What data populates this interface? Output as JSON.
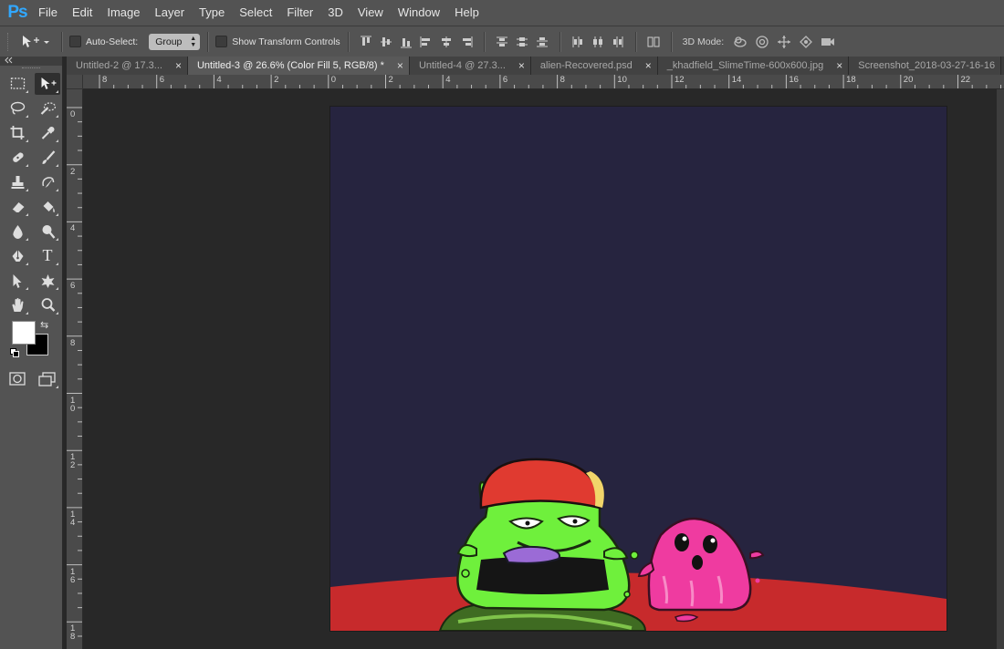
{
  "app": {
    "logo": "Ps"
  },
  "menu": [
    "File",
    "Edit",
    "Image",
    "Layer",
    "Type",
    "Select",
    "Filter",
    "3D",
    "View",
    "Window",
    "Help"
  ],
  "options": {
    "auto_select_label": "Auto-Select:",
    "auto_select_checked": false,
    "auto_select_target": "Group",
    "show_transform_label": "Show Transform Controls",
    "show_transform_checked": false,
    "mode3d_label": "3D Mode:"
  },
  "tabs": [
    {
      "title": "Untitled-2 @ 17.3...",
      "active": false
    },
    {
      "title": "Untitled-3 @ 26.6% (Color Fill 5, RGB/8) *",
      "active": true
    },
    {
      "title": "Untitled-4 @ 27.3...",
      "active": false
    },
    {
      "title": "alien-Recovered.psd",
      "active": false
    },
    {
      "title": "_khadfield_SlimeTime-600x600.jpg",
      "active": false
    },
    {
      "title": "Screenshot_2018-03-27-16-16",
      "active": false
    }
  ],
  "tab_close_glyph": "×",
  "ruler": {
    "horizontal": [
      "8",
      "6",
      "4",
      "2",
      "0",
      "2",
      "4",
      "6",
      "8",
      "10",
      "12",
      "14",
      "16",
      "18",
      "20",
      "22"
    ],
    "vertical": [
      "0",
      "2",
      "4",
      "6",
      "8",
      "10",
      "12",
      "14",
      "16",
      "18"
    ]
  },
  "colors": {
    "foreground": "#ffffff",
    "background": "#000000",
    "canvas_bg": "#26243f",
    "ground": "#c72a2c",
    "green_slime": "#6ff03c",
    "pink_slime": "#ef3ba0",
    "cap": "#e03a30"
  },
  "tools": [
    [
      "marquee-icon",
      "move-icon"
    ],
    [
      "lasso-icon",
      "quick-select-icon"
    ],
    [
      "crop-icon",
      "eyedropper-icon"
    ],
    [
      "healing-brush-icon",
      "brush-icon"
    ],
    [
      "clone-stamp-icon",
      "history-brush-icon"
    ],
    [
      "eraser-icon",
      "paint-bucket-icon"
    ],
    [
      "blur-icon",
      "dodge-icon"
    ],
    [
      "pen-icon",
      "type-icon"
    ],
    [
      "path-select-icon",
      "custom-shape-icon"
    ],
    [
      "hand-icon",
      "zoom-icon"
    ]
  ],
  "type_tool_glyph": "T",
  "swap_glyph": "⇆"
}
